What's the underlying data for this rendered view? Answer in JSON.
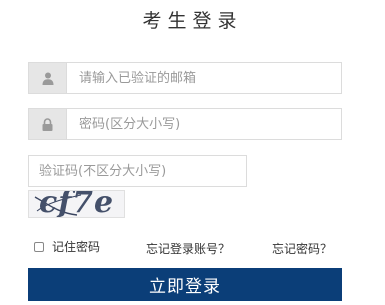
{
  "title": "考生登录",
  "email": {
    "placeholder": "请输入已验证的邮箱",
    "icon": "user-icon"
  },
  "password": {
    "placeholder": "密码(区分大小写)",
    "icon": "lock-icon"
  },
  "captcha": {
    "placeholder": "验证码(不区分大小写)",
    "image_text": "cf7e"
  },
  "options": {
    "remember_label": "记住密码",
    "forgot_account_label": "忘记登录账号？",
    "forgot_password_label": "忘记密码？"
  },
  "login_button_label": "立即登录",
  "colors": {
    "accent": "#0b3e78",
    "addon_bg": "#e6e6e6",
    "border": "#dcdcdc"
  }
}
